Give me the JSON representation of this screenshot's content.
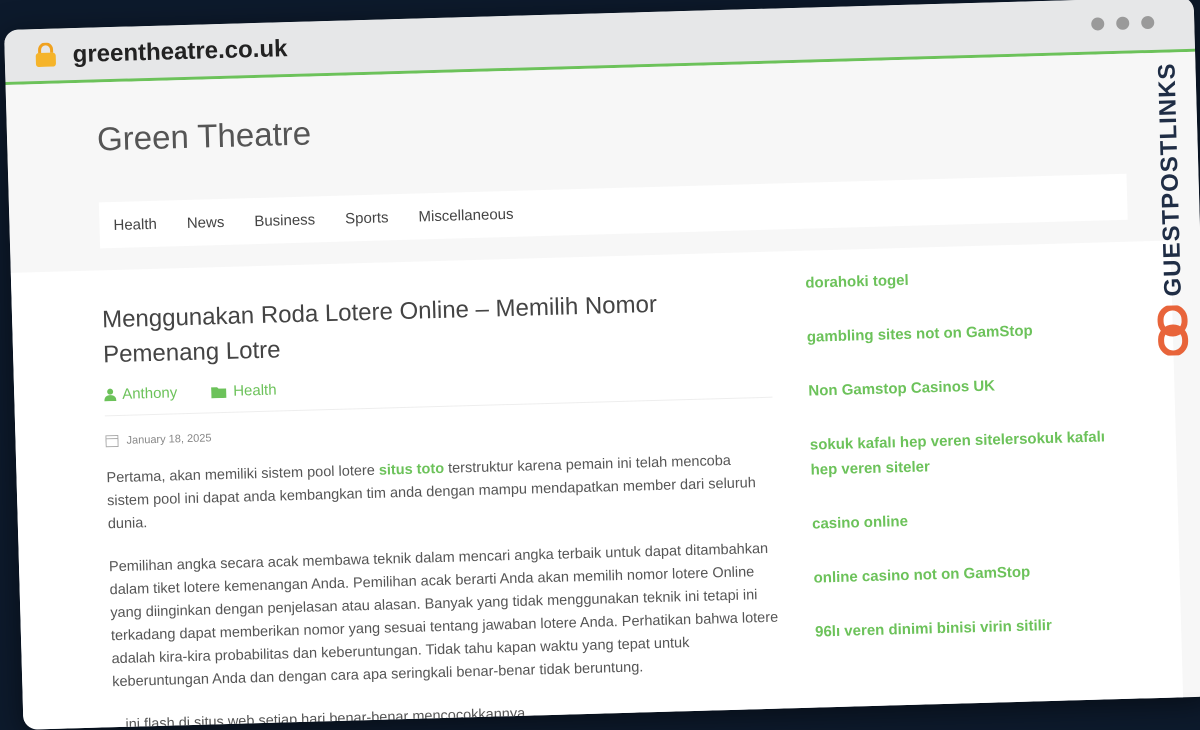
{
  "browser": {
    "domain": "greentheatre.co.uk"
  },
  "site": {
    "title": "Green Theatre"
  },
  "nav": [
    "Health",
    "News",
    "Business",
    "Sports",
    "Miscellaneous"
  ],
  "post": {
    "title": "Menggunakan Roda Lotere Online – Memilih Nomor Pemenang Lotre",
    "author": "Anthony",
    "category": "Health",
    "date": "January 18, 2025",
    "p1_before": "Pertama, akan memiliki sistem pool lotere ",
    "p1_link": "situs toto",
    "p1_after": " terstruktur karena pemain ini telah mencoba sistem pool ini dapat anda kembangkan tim anda dengan mampu mendapatkan member dari seluruh dunia.",
    "p2": "Pemilihan angka secara acak membawa teknik dalam mencari angka terbaik untuk dapat ditambahkan dalam tiket lotere kemenangan Anda. Pemilihan acak berarti Anda akan memilih nomor lotere Online yang diinginkan dengan penjelasan atau alasan. Banyak yang tidak menggunakan teknik ini tetapi ini terkadang dapat memberikan nomor yang sesuai tentang jawaban lotere Anda. Perhatikan bahwa lotere adalah kira-kira probabilitas dan keberuntungan. Tidak tahu kapan waktu yang tepat untuk keberuntungan Anda dan dengan cara apa seringkali benar-benar tidak beruntung.",
    "p3": "...ini flash di situs web setiap hari benar-benar mencocokkannya"
  },
  "sidebar": [
    "dorahoki togel",
    "gambling sites not on GamStop",
    "Non Gamstop Casinos UK",
    "sokuk kafalı hep veren sitelersokuk kafalı hep veren siteler",
    "casino online",
    "online casino not on GamStop",
    "96lı veren dinimi binisi virin sitilir"
  ],
  "watermark": {
    "text": "GUESTPOSTLINKS"
  },
  "colors": {
    "accent": "#6cc25a",
    "brand": "#1f2d45",
    "logo": "#e8643a"
  },
  "icons": [
    "lock-icon",
    "user-icon",
    "folder-icon",
    "calendar-icon",
    "link-logo-icon"
  ]
}
